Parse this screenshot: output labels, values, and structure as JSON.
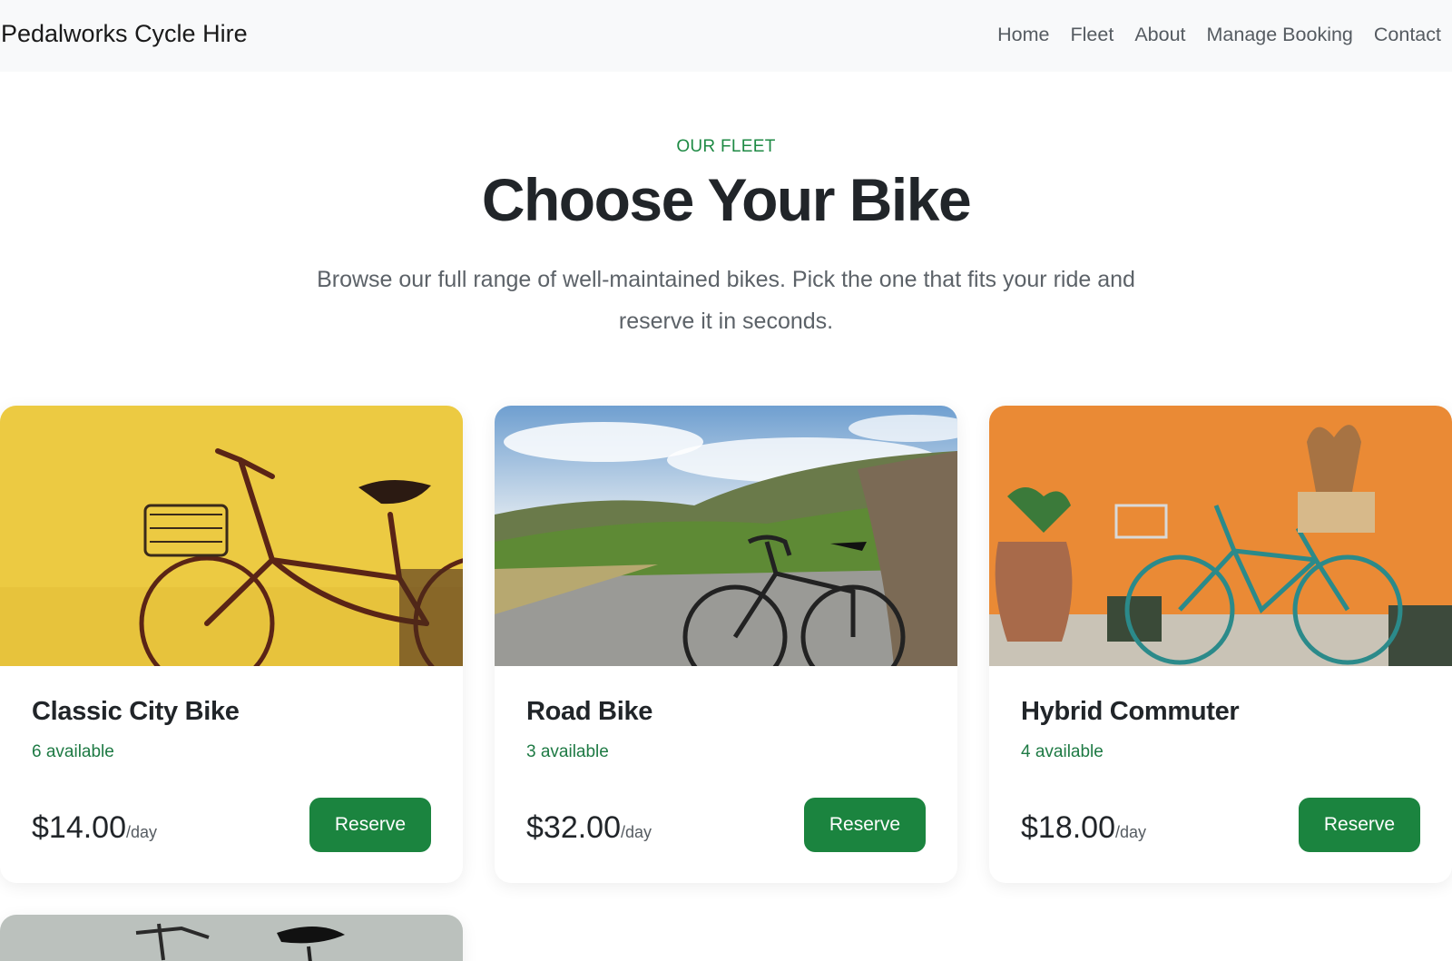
{
  "nav": {
    "brand": "Pedalworks Cycle Hire",
    "links": [
      "Home",
      "Fleet",
      "About",
      "Manage Booking",
      "Contact"
    ]
  },
  "hero": {
    "eyebrow": "OUR FLEET",
    "title": "Choose Your Bike",
    "subtitle": "Browse our full range of well-maintained bikes. Pick the one that fits your ride and reserve it in seconds."
  },
  "bikes": [
    {
      "name": "Classic City Bike",
      "availability": "6 available",
      "price": "$14.00",
      "unit": "/day",
      "button": "Reserve",
      "image": "yellow-wall-city-bike-photo"
    },
    {
      "name": "Road Bike",
      "availability": "3 available",
      "price": "$32.00",
      "unit": "/day",
      "button": "Reserve",
      "image": "road-bikes-vineyard-photo"
    },
    {
      "name": "Hybrid Commuter",
      "availability": "4 available",
      "price": "$18.00",
      "unit": "/day",
      "button": "Reserve",
      "image": "teal-bike-orange-wall-photo"
    },
    {
      "image": "partial-bike-photo"
    }
  ],
  "colors": {
    "accent": "#1b843f",
    "navbar_bg": "#f8f9fa",
    "heading": "#212529"
  }
}
